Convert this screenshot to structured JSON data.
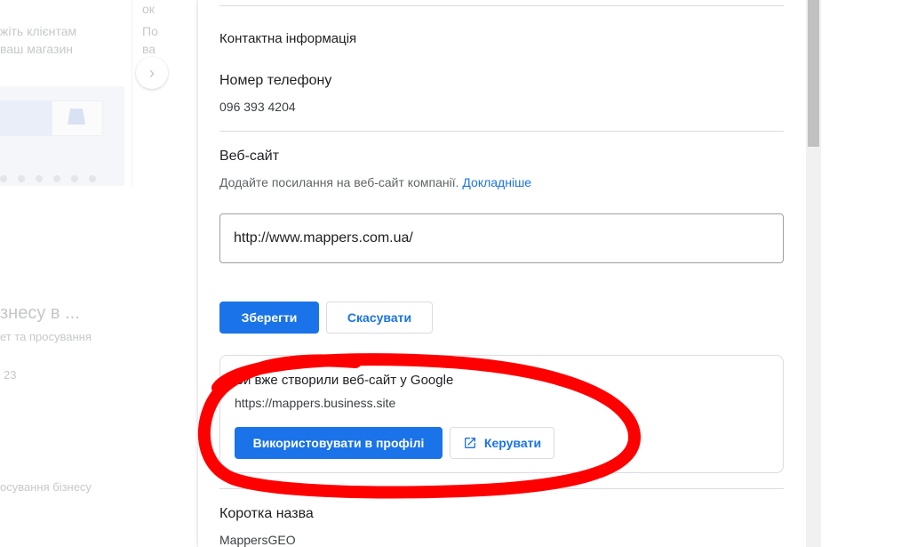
{
  "background": {
    "card_text_line1": "жіть клієнтам",
    "card_text_line2": "ваш магазин",
    "card2_title": "ок",
    "card2_line1": "По",
    "card2_line2": "ва",
    "next_arrow": "›",
    "section_heading": "знесу в ...",
    "section_sub": "ет та просування",
    "count": "23",
    "bottom_text": "осування бізнесу"
  },
  "panel": {
    "contact_title": "Контактна інформація",
    "phone_label": "Номер телефону",
    "phone_value": "096 393 4204",
    "website_label": "Веб-сайт",
    "website_help": "Додайте посилання на веб-сайт компанії.",
    "website_help_link": "Докладніше",
    "website_value": "http://www.mappers.com.ua/",
    "save_label": "Зберегти",
    "cancel_label": "Скасувати",
    "google_site": {
      "title": "Ви вже створили веб-сайт у Google",
      "url": "https://mappers.business.site",
      "use_label": "Використовувати в профілі",
      "manage_label": "Керувати",
      "manage_icon": "open-in-new-icon"
    },
    "short_name_label": "Коротка назва",
    "short_name_value": "MappersGEO"
  },
  "colors": {
    "accent": "#1a73e8",
    "annotation": "#ff0000"
  }
}
